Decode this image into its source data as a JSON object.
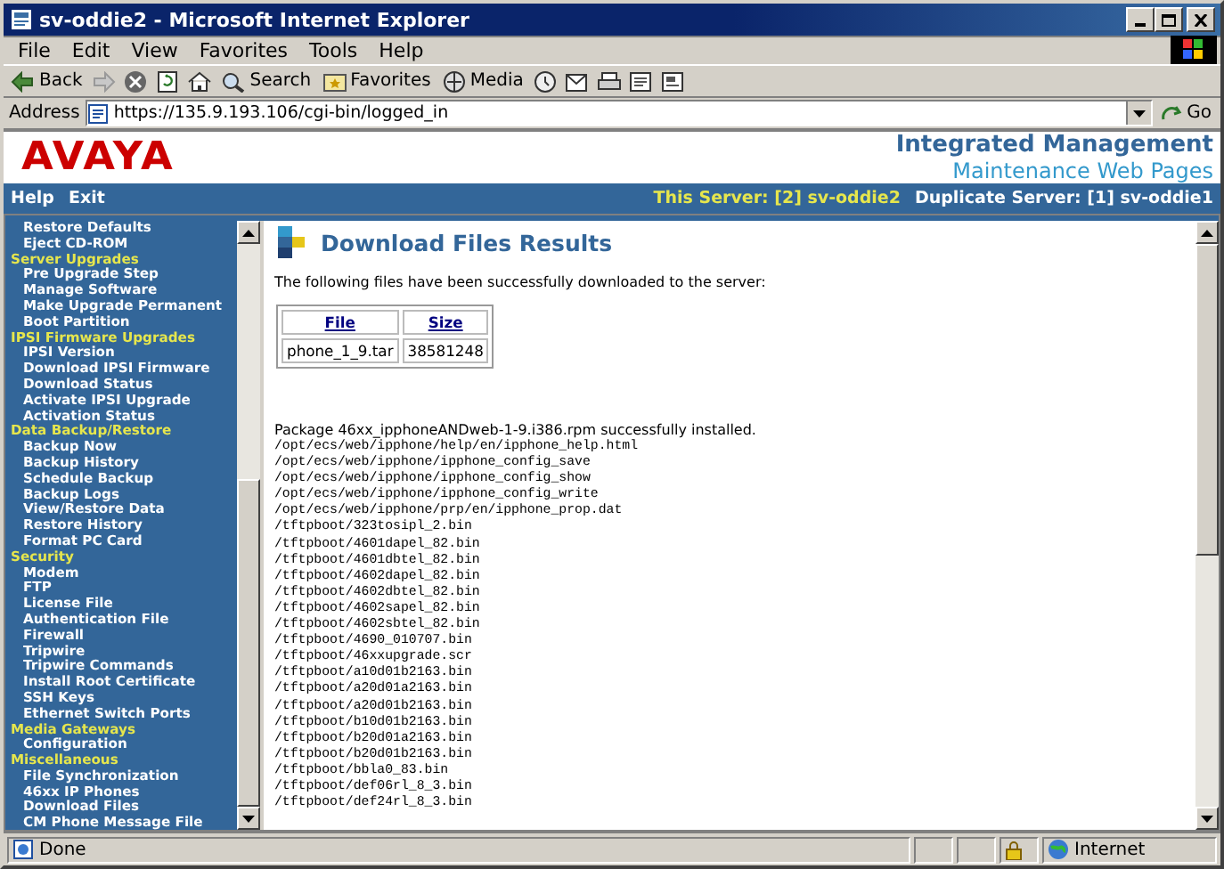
{
  "window": {
    "title": "sv-oddie2 - Microsoft Internet Explorer"
  },
  "menu": [
    "File",
    "Edit",
    "View",
    "Favorites",
    "Tools",
    "Help"
  ],
  "toolbar": [
    {
      "kind": "back",
      "label": "Back"
    },
    {
      "kind": "forward"
    },
    {
      "kind": "stop"
    },
    {
      "kind": "refresh"
    },
    {
      "kind": "home"
    },
    {
      "kind": "search",
      "label": "Search"
    },
    {
      "kind": "favorites",
      "label": "Favorites"
    },
    {
      "kind": "media",
      "label": "Media"
    },
    {
      "kind": "history"
    },
    {
      "kind": "mail"
    },
    {
      "kind": "print"
    },
    {
      "kind": "edit"
    },
    {
      "kind": "discuss"
    }
  ],
  "address": {
    "label": "Address",
    "value": "https://135.9.193.106/cgi-bin/logged_in",
    "go": "Go"
  },
  "header": {
    "logo": "AVAYA",
    "title": "Integrated Management",
    "subtitle": "Maintenance Web Pages"
  },
  "nav": {
    "links": [
      "Help",
      "Exit"
    ],
    "this_server": "This Server: [2] sv-oddie2",
    "duplicate_server": "Duplicate Server: [1] sv-oddie1"
  },
  "sidebar": {
    "items": [
      {
        "kind": "link",
        "label": "Restore Defaults"
      },
      {
        "kind": "link",
        "label": "Eject CD-ROM"
      },
      {
        "kind": "heading",
        "label": "Server Upgrades"
      },
      {
        "kind": "link",
        "label": "Pre Upgrade Step"
      },
      {
        "kind": "link",
        "label": "Manage Software"
      },
      {
        "kind": "link",
        "label": "Make Upgrade Permanent"
      },
      {
        "kind": "link",
        "label": "Boot Partition"
      },
      {
        "kind": "heading",
        "label": "IPSI Firmware Upgrades"
      },
      {
        "kind": "link",
        "label": "IPSI Version"
      },
      {
        "kind": "link",
        "label": "Download IPSI Firmware"
      },
      {
        "kind": "link",
        "label": "Download Status"
      },
      {
        "kind": "link",
        "label": "Activate IPSI Upgrade"
      },
      {
        "kind": "link",
        "label": "Activation Status"
      },
      {
        "kind": "heading",
        "label": "Data Backup/Restore"
      },
      {
        "kind": "link",
        "label": "Backup Now"
      },
      {
        "kind": "link",
        "label": "Backup History"
      },
      {
        "kind": "link",
        "label": "Schedule Backup"
      },
      {
        "kind": "link",
        "label": "Backup Logs"
      },
      {
        "kind": "link",
        "label": "View/Restore Data"
      },
      {
        "kind": "link",
        "label": "Restore History"
      },
      {
        "kind": "link",
        "label": "Format PC Card"
      },
      {
        "kind": "heading",
        "label": "Security"
      },
      {
        "kind": "link",
        "label": "Modem"
      },
      {
        "kind": "link",
        "label": "FTP"
      },
      {
        "kind": "link",
        "label": "License File"
      },
      {
        "kind": "link",
        "label": "Authentication File"
      },
      {
        "kind": "link",
        "label": "Firewall"
      },
      {
        "kind": "link",
        "label": "Tripwire"
      },
      {
        "kind": "link",
        "label": "Tripwire Commands"
      },
      {
        "kind": "link",
        "label": "Install Root Certificate"
      },
      {
        "kind": "link",
        "label": "SSH Keys"
      },
      {
        "kind": "link",
        "label": "Ethernet Switch Ports"
      },
      {
        "kind": "heading",
        "label": "Media Gateways"
      },
      {
        "kind": "link",
        "label": "Configuration"
      },
      {
        "kind": "heading",
        "label": "Miscellaneous"
      },
      {
        "kind": "link",
        "label": "File Synchronization"
      },
      {
        "kind": "link",
        "label": "46xx IP Phones"
      },
      {
        "kind": "link",
        "label": "Download Files"
      },
      {
        "kind": "link",
        "label": "CM Phone Message File"
      }
    ]
  },
  "content": {
    "title": "Download Files Results",
    "intro": "The following files have been successfully downloaded to the server:",
    "table": {
      "columns": [
        "File",
        "Size"
      ],
      "rows": [
        [
          "phone_1_9.tar",
          "38581248"
        ]
      ]
    },
    "package": "Package  46xx_ipphoneANDweb-1-9.i386.rpm successfully installed.",
    "files": [
      "/opt/ecs/web/ipphone/help/en/ipphone_help.html",
      "/opt/ecs/web/ipphone/ipphone_config_save",
      "/opt/ecs/web/ipphone/ipphone_config_show",
      "/opt/ecs/web/ipphone/ipphone_config_write",
      "/opt/ecs/web/ipphone/prp/en/ipphone_prop.dat",
      "/tftpboot/323tosipl_2.bin",
      "/tftpboot/4601dapel_82.bin",
      "/tftpboot/4601dbtel_82.bin",
      "/tftpboot/4602dapel_82.bin",
      "/tftpboot/4602dbtel_82.bin",
      "/tftpboot/4602sapel_82.bin",
      "/tftpboot/4602sbtel_82.bin",
      "/tftpboot/4690_010707.bin",
      "/tftpboot/46xxupgrade.scr",
      "/tftpboot/a10d01b2163.bin",
      "/tftpboot/a20d01a2163.bin",
      "/tftpboot/a20d01b2163.bin",
      "/tftpboot/b10d01b2163.bin",
      "/tftpboot/b20d01a2163.bin",
      "/tftpboot/b20d01b2163.bin",
      "/tftpboot/bbla0_83.bin",
      "/tftpboot/def06rl_8_3.bin",
      "/tftpboot/def24rl_8_3.bin"
    ]
  },
  "status_bar": {
    "text": "Done",
    "zone": "Internet"
  }
}
